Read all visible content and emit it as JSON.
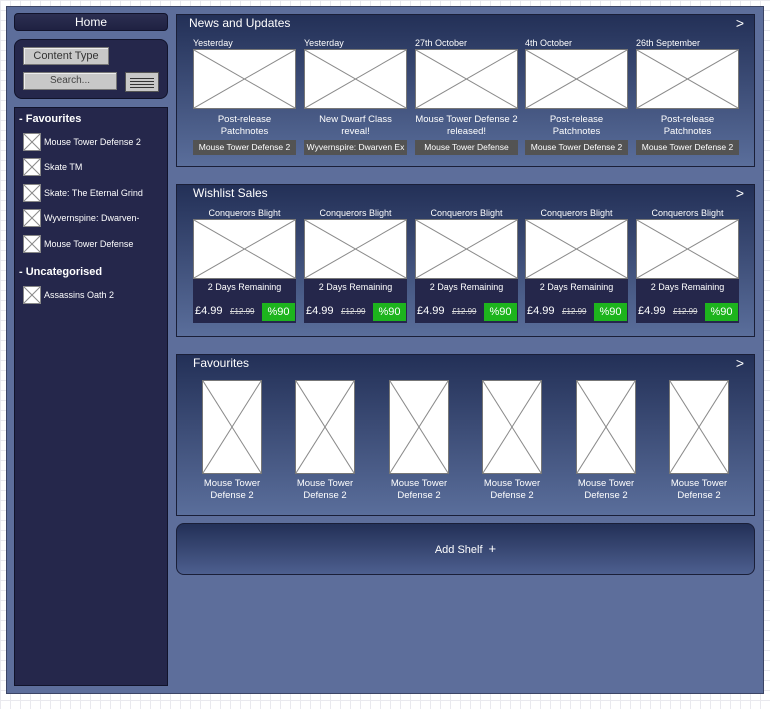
{
  "sidebar": {
    "home_label": "Home",
    "content_type_label": "Content Type",
    "search_placeholder": "Search...",
    "groups": [
      {
        "heading": "- Favourites",
        "items": [
          {
            "label": "Mouse Tower Defense 2"
          },
          {
            "label": "Skate TM"
          },
          {
            "label": "Skate: The Eternal Grind"
          },
          {
            "label": "Wyvernspine: Dwarven-"
          },
          {
            "label": "Mouse Tower Defense"
          }
        ]
      },
      {
        "heading": "- Uncategorised",
        "items": [
          {
            "label": "Assassins Oath 2"
          }
        ]
      }
    ]
  },
  "news": {
    "title": "News and Updates",
    "arrow": ">",
    "cards": [
      {
        "date": "Yesterday",
        "title": "Post-release Patchnotes",
        "game": "Mouse Tower Defense 2"
      },
      {
        "date": "Yesterday",
        "title": "New Dwarf Class reveal!",
        "game": "Wyvernspire: Dwarven Ex"
      },
      {
        "date": "27th October",
        "title": "Mouse Tower Defense 2 released!",
        "game": "Mouse Tower Defense"
      },
      {
        "date": "4th October",
        "title": "Post-release Patchnotes",
        "game": "Mouse Tower Defense 2"
      },
      {
        "date": "26th September",
        "title": "Post-release Patchnotes",
        "game": "Mouse Tower Defense 2"
      }
    ]
  },
  "wishlist": {
    "title": "Wishlist Sales",
    "arrow": ">",
    "cards": [
      {
        "game": "Conquerors Blight",
        "remaining": "2 Days Remaining",
        "price": "£4.99",
        "old_price": "£12.99",
        "discount": "%90"
      },
      {
        "game": "Conquerors Blight",
        "remaining": "2 Days Remaining",
        "price": "£4.99",
        "old_price": "£12.99",
        "discount": "%90"
      },
      {
        "game": "Conquerors Blight",
        "remaining": "2 Days Remaining",
        "price": "£4.99",
        "old_price": "£12.99",
        "discount": "%90"
      },
      {
        "game": "Conquerors Blight",
        "remaining": "2 Days Remaining",
        "price": "£4.99",
        "old_price": "£12.99",
        "discount": "%90"
      },
      {
        "game": "Conquerors Blight",
        "remaining": "2 Days Remaining",
        "price": "£4.99",
        "old_price": "£12.99",
        "discount": "%90"
      }
    ],
    "discount_color": "#1db41d"
  },
  "favourites": {
    "title": "Favourites",
    "arrow": ">",
    "cards": [
      {
        "title": "Mouse Tower Defense 2"
      },
      {
        "title": "Mouse Tower Defense 2"
      },
      {
        "title": "Mouse Tower Defense 2"
      },
      {
        "title": "Mouse Tower Defense 2"
      },
      {
        "title": "Mouse Tower Defense 2"
      },
      {
        "title": "Mouse Tower Defense 2"
      }
    ]
  },
  "add_shelf": {
    "label": "Add Shelf",
    "icon": "+"
  }
}
